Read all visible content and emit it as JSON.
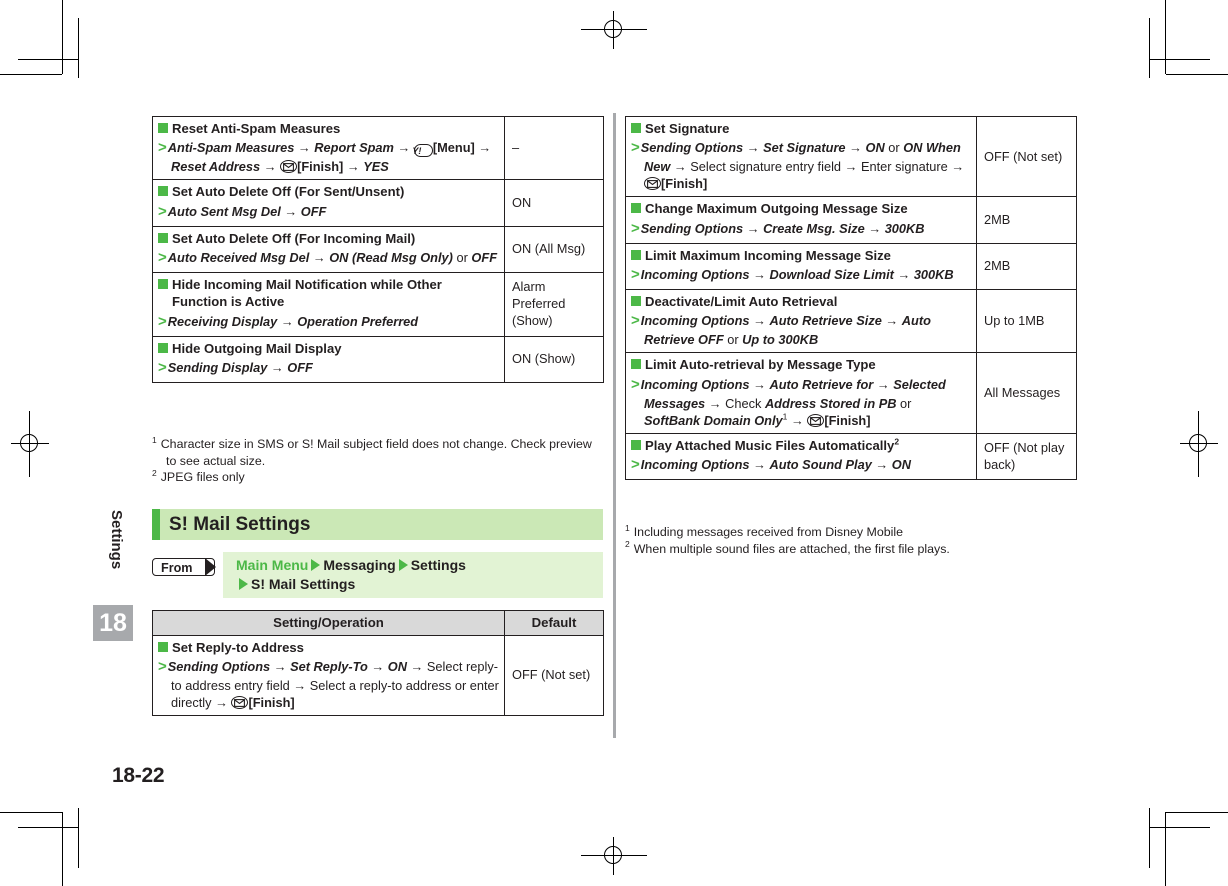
{
  "page": {
    "folio": "18-22",
    "chapter_name": "Settings",
    "chapter_number": "18"
  },
  "colors": {
    "green": "#4cb847",
    "green_light": "#cbe8b6",
    "green_pale": "#e2f3d4",
    "header_gray": "#d9d9d9",
    "tab_gray": "#a7a9ac",
    "text": "#231f20"
  },
  "left_column": {
    "table_rows": [
      {
        "heading": "Reset Anti-Spam Measures",
        "operation_parts": [
          {
            "t": "Anti-Spam Measures",
            "s": "b"
          },
          {
            "t": " → ",
            "s": "ar"
          },
          {
            "t": "Report Spam",
            "s": "b"
          },
          {
            "t": " → ",
            "s": "ar"
          },
          {
            "t": "Y!",
            "s": "key"
          },
          {
            "t": "[Menu]",
            "s": "pb"
          },
          {
            "t": " → ",
            "s": "ar"
          },
          {
            "t": "Reset Address",
            "s": "b"
          },
          {
            "t": " → ",
            "s": "ar"
          },
          {
            "t": "mail",
            "s": "keyicon"
          },
          {
            "t": "[Finish]",
            "s": "pb"
          },
          {
            "t": " → ",
            "s": "ar"
          },
          {
            "t": "YES",
            "s": "b"
          }
        ],
        "default": "–"
      },
      {
        "heading": "Set Auto Delete Off (For Sent/Unsent)",
        "operation_parts": [
          {
            "t": "Auto Sent Msg Del",
            "s": "b"
          },
          {
            "t": " → ",
            "s": "ar"
          },
          {
            "t": "OFF",
            "s": "b"
          }
        ],
        "default": "ON"
      },
      {
        "heading": "Set Auto Delete Off (For Incoming Mail)",
        "operation_parts": [
          {
            "t": "Auto Received Msg Del",
            "s": "b"
          },
          {
            "t": " → ",
            "s": "ar"
          },
          {
            "t": "ON (Read Msg Only)",
            "s": "b"
          },
          {
            "t": " or ",
            "s": "pl"
          },
          {
            "t": "OFF",
            "s": "b"
          }
        ],
        "default": "ON (All Msg)"
      },
      {
        "heading": "Hide Incoming Mail Notification while Other Function is Active",
        "operation_parts": [
          {
            "t": "Receiving Display",
            "s": "b"
          },
          {
            "t": " → ",
            "s": "ar"
          },
          {
            "t": "Operation Preferred",
            "s": "b"
          }
        ],
        "default": "Alarm Preferred (Show)"
      },
      {
        "heading": "Hide Outgoing Mail Display",
        "operation_parts": [
          {
            "t": "Sending Display",
            "s": "b"
          },
          {
            "t": " → ",
            "s": "ar"
          },
          {
            "t": "OFF",
            "s": "b"
          }
        ],
        "default": "ON (Show)"
      }
    ],
    "footnotes": [
      {
        "num": "1",
        "text": "Character size in SMS or S! Mail subject field does not change. Check preview to see actual size."
      },
      {
        "num": "2",
        "text": "JPEG files only"
      }
    ],
    "section": {
      "title": "S! Mail Settings",
      "from_label": "From",
      "path": [
        "Main Menu",
        "Messaging",
        "Settings",
        "S! Mail Settings"
      ]
    },
    "table2_headers": {
      "setting": "Setting/Operation",
      "default": "Default"
    },
    "table2_rows": [
      {
        "heading": "Set Reply-to Address",
        "operation_parts": [
          {
            "t": "Sending Options",
            "s": "b"
          },
          {
            "t": " → ",
            "s": "ar"
          },
          {
            "t": "Set Reply-To",
            "s": "b"
          },
          {
            "t": " → ",
            "s": "ar"
          },
          {
            "t": "ON",
            "s": "b"
          },
          {
            "t": " → ",
            "s": "ar"
          },
          {
            "t": "Select reply-to address entry field",
            "s": "pl"
          },
          {
            "t": " → ",
            "s": "ar"
          },
          {
            "t": "Select a reply-to address or enter directly",
            "s": "pl"
          },
          {
            "t": " → ",
            "s": "ar"
          },
          {
            "t": "mail",
            "s": "keyicon"
          },
          {
            "t": "[Finish]",
            "s": "pb"
          }
        ],
        "default": "OFF (Not set)"
      }
    ]
  },
  "right_column": {
    "table_rows": [
      {
        "heading": "Set Signature",
        "operation_parts": [
          {
            "t": "Sending Options",
            "s": "b"
          },
          {
            "t": " → ",
            "s": "ar"
          },
          {
            "t": "Set Signature",
            "s": "b"
          },
          {
            "t": " → ",
            "s": "ar"
          },
          {
            "t": "ON",
            "s": "b"
          },
          {
            "t": " or ",
            "s": "pl"
          },
          {
            "t": "ON When New",
            "s": "b"
          },
          {
            "t": " → ",
            "s": "ar"
          },
          {
            "t": "Select signature entry field",
            "s": "pl"
          },
          {
            "t": " → ",
            "s": "ar"
          },
          {
            "t": "Enter signature",
            "s": "pl"
          },
          {
            "t": " → ",
            "s": "ar"
          },
          {
            "t": "mail",
            "s": "keyicon"
          },
          {
            "t": "[Finish]",
            "s": "pb"
          }
        ],
        "default": "OFF (Not set)"
      },
      {
        "heading": "Change Maximum Outgoing Message Size",
        "operation_parts": [
          {
            "t": "Sending Options",
            "s": "b"
          },
          {
            "t": " → ",
            "s": "ar"
          },
          {
            "t": "Create Msg. Size",
            "s": "b"
          },
          {
            "t": " → ",
            "s": "ar"
          },
          {
            "t": "300KB",
            "s": "b"
          }
        ],
        "default": "2MB"
      },
      {
        "heading": "Limit Maximum Incoming Message Size",
        "operation_parts": [
          {
            "t": "Incoming Options",
            "s": "b"
          },
          {
            "t": " → ",
            "s": "ar"
          },
          {
            "t": "Download Size Limit",
            "s": "b"
          },
          {
            "t": " → ",
            "s": "ar"
          },
          {
            "t": "300KB",
            "s": "b"
          }
        ],
        "default": "2MB"
      },
      {
        "heading": "Deactivate/Limit Auto Retrieval",
        "operation_parts": [
          {
            "t": "Incoming Options",
            "s": "b"
          },
          {
            "t": " → ",
            "s": "ar"
          },
          {
            "t": "Auto Retrieve Size",
            "s": "b"
          },
          {
            "t": " → ",
            "s": "ar"
          },
          {
            "t": "Auto Retrieve OFF",
            "s": "b"
          },
          {
            "t": " or ",
            "s": "pl"
          },
          {
            "t": "Up to 300KB",
            "s": "b"
          }
        ],
        "default": "Up to 1MB"
      },
      {
        "heading": "Limit Auto-retrieval by Message Type",
        "operation_parts": [
          {
            "t": "Incoming Options",
            "s": "b"
          },
          {
            "t": " → ",
            "s": "ar"
          },
          {
            "t": "Auto Retrieve for",
            "s": "b"
          },
          {
            "t": " → ",
            "s": "ar"
          },
          {
            "t": "Selected Messages",
            "s": "b"
          },
          {
            "t": " → ",
            "s": "ar"
          },
          {
            "t": "Check ",
            "s": "pl"
          },
          {
            "t": "Address Stored in PB",
            "s": "b"
          },
          {
            "t": " or ",
            "s": "pl"
          },
          {
            "t": "SoftBank Domain Only",
            "s": "b"
          },
          {
            "t": "1",
            "s": "sup"
          },
          {
            "t": " → ",
            "s": "ar"
          },
          {
            "t": "mail",
            "s": "keyicon"
          },
          {
            "t": "[Finish]",
            "s": "pb"
          }
        ],
        "default": "All Messages"
      },
      {
        "heading": "Play Attached Music Files Automatically",
        "heading_sup": "2",
        "operation_parts": [
          {
            "t": "Incoming Options",
            "s": "b"
          },
          {
            "t": " → ",
            "s": "ar"
          },
          {
            "t": "Auto Sound Play",
            "s": "b"
          },
          {
            "t": " → ",
            "s": "ar"
          },
          {
            "t": "ON",
            "s": "b"
          }
        ],
        "default": "OFF (Not play back)"
      }
    ],
    "footnotes": [
      {
        "num": "1",
        "text": "Including messages received from Disney Mobile"
      },
      {
        "num": "2",
        "text": "When multiple sound files are attached, the first file plays."
      }
    ]
  }
}
